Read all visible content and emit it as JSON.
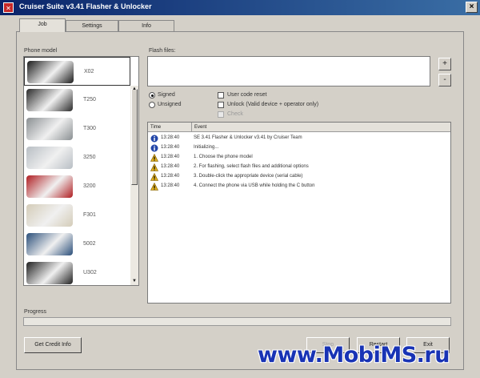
{
  "window": {
    "title": "Cruiser Suite v3.41 Flasher & Unlocker",
    "close_glyph": "×"
  },
  "tabs": [
    {
      "label": "Job",
      "active": true
    },
    {
      "label": "Settings",
      "active": false
    },
    {
      "label": "Info",
      "active": false
    }
  ],
  "phone_model": {
    "label": "Phone model",
    "selected": "X02",
    "items": [
      {
        "label": "X02",
        "color": "#1c1c1c",
        "icon": "phone-thumbnail"
      },
      {
        "label": "T250",
        "color": "#2a2a2a",
        "icon": "phone-thumbnail"
      },
      {
        "label": "T300",
        "color": "#8a8f92",
        "icon": "phone-thumbnail"
      },
      {
        "label": "3250",
        "color": "#b8bec4",
        "icon": "phone-thumbnail"
      },
      {
        "label": "3200",
        "color": "#b01e22",
        "icon": "phone-thumbnail"
      },
      {
        "label": "F301",
        "color": "#d4ccb8",
        "icon": "phone-thumbnail"
      },
      {
        "label": "5002",
        "color": "#2b4f7a",
        "icon": "phone-thumbnail"
      },
      {
        "label": "U302",
        "color": "#202020",
        "icon": "phone-thumbnail"
      }
    ]
  },
  "flash_files": {
    "label": "Flash files:",
    "add_glyph": "+",
    "remove_glyph": "-"
  },
  "options": {
    "signed": "Signed",
    "unsigned": "Unsigned",
    "user_code_reset": "User code reset",
    "unlock": "Unlock (Valid device + operator only)",
    "check": "Check"
  },
  "log": {
    "columns": [
      "Time",
      "Event"
    ],
    "rows": [
      {
        "type": "info",
        "time": "13:28:40",
        "message": "SE 3.41 Flasher & Unlocker v3.41 by Cruiser Team"
      },
      {
        "type": "info",
        "time": "13:28:40",
        "message": "Initializing..."
      },
      {
        "type": "warning",
        "time": "13:28:40",
        "message": "1. Choose the phone model"
      },
      {
        "type": "warning",
        "time": "13:28:40",
        "message": "2. For flashing, select flash files and additional options"
      },
      {
        "type": "warning",
        "time": "13:28:40",
        "message": "3. Double-click the appropriate device (serial cable)"
      },
      {
        "type": "warning",
        "time": "13:28:40",
        "message": "4. Connect the phone via USB while holding the C button"
      }
    ]
  },
  "progress": {
    "label": "Progress",
    "value": 0
  },
  "buttons": {
    "get_credit": "Get Credit Info",
    "stop": "Stop",
    "restart": "Restart",
    "exit": "Exit"
  },
  "watermark": "www.MobiMS.ru",
  "colors": {
    "titlebar_start": "#0a246a",
    "titlebar_end": "#3a6ea5",
    "info_icon": "#2346a8",
    "warning_icon": "#e0b020",
    "watermark": "#1833b5"
  }
}
